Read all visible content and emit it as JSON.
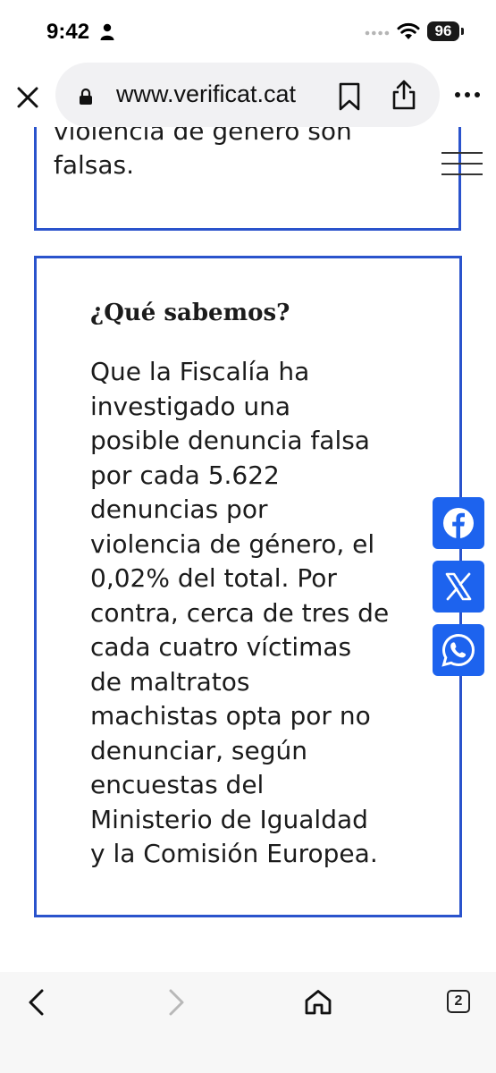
{
  "status": {
    "time": "9:42",
    "battery": "96"
  },
  "browser": {
    "url": "www.verificat.cat"
  },
  "article": {
    "previous_card_lines": [
      "violencia de género son",
      "falsas."
    ],
    "card_heading": "¿Qué sabemos?",
    "card_body_lines": [
      "Que la Fiscalía ha",
      "investigado una",
      "posible denuncia falsa",
      "por cada 5.622",
      "denuncias por",
      "violencia de género, el",
      "0,02% del total. Por",
      "contra, cerca de tres de",
      "cada cuatro víctimas",
      "de maltratos",
      "machistas opta por no",
      "denunciar, según",
      "encuestas del",
      "Ministerio de Igualdad",
      "y la Comisión Europea."
    ]
  },
  "share": {
    "buttons": [
      "facebook-icon",
      "x-icon",
      "whatsapp-icon"
    ],
    "accent": "#1d63ee"
  },
  "toolbar": {
    "tab_count": "2"
  },
  "colors": {
    "card_border": "#2a53cc",
    "text": "#1b1b1b"
  }
}
